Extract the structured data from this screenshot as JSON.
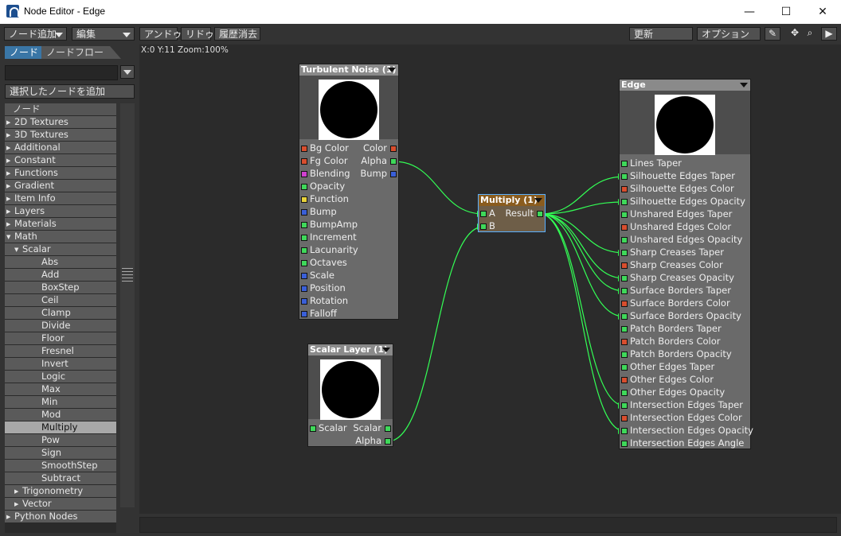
{
  "window": {
    "title": "Node Editor - Edge",
    "minimize": "—",
    "maximize": "☐",
    "close": "✕"
  },
  "toolbar": {
    "add_node": "ノード追加",
    "edit": "編集",
    "undo": "アンドゥ",
    "redo": "リドゥ",
    "clear_history": "履歴消去",
    "update": "更新",
    "options": "オプション"
  },
  "left": {
    "tab_nodes": "ノード",
    "tab_flow": "ノードフロー",
    "add_selected": "選択したノードを追加",
    "tree_header": "ノード",
    "tree": [
      {
        "label": "2D Textures",
        "level": 0,
        "expand": "closed"
      },
      {
        "label": "3D Textures",
        "level": 0,
        "expand": "closed"
      },
      {
        "label": "Additional",
        "level": 0,
        "expand": "closed"
      },
      {
        "label": "Constant",
        "level": 0,
        "expand": "closed"
      },
      {
        "label": "Functions",
        "level": 0,
        "expand": "closed"
      },
      {
        "label": "Gradient",
        "level": 0,
        "expand": "closed"
      },
      {
        "label": "Item Info",
        "level": 0,
        "expand": "closed"
      },
      {
        "label": "Layers",
        "level": 0,
        "expand": "closed"
      },
      {
        "label": "Materials",
        "level": 0,
        "expand": "closed"
      },
      {
        "label": "Math",
        "level": 0,
        "expand": "open"
      },
      {
        "label": "Scalar",
        "level": 1,
        "expand": "open"
      },
      {
        "label": "Abs",
        "level": 2
      },
      {
        "label": "Add",
        "level": 2
      },
      {
        "label": "BoxStep",
        "level": 2
      },
      {
        "label": "Ceil",
        "level": 2
      },
      {
        "label": "Clamp",
        "level": 2
      },
      {
        "label": "Divide",
        "level": 2
      },
      {
        "label": "Floor",
        "level": 2
      },
      {
        "label": "Fresnel",
        "level": 2
      },
      {
        "label": "Invert",
        "level": 2
      },
      {
        "label": "Logic",
        "level": 2
      },
      {
        "label": "Max",
        "level": 2
      },
      {
        "label": "Min",
        "level": 2
      },
      {
        "label": "Mod",
        "level": 2
      },
      {
        "label": "Multiply",
        "level": 2,
        "selected": true
      },
      {
        "label": "Pow",
        "level": 2
      },
      {
        "label": "Sign",
        "level": 2
      },
      {
        "label": "SmoothStep",
        "level": 2
      },
      {
        "label": "Subtract",
        "level": 2
      },
      {
        "label": "Trigonometry",
        "level": 1,
        "expand": "closed"
      },
      {
        "label": "Vector",
        "level": 1,
        "expand": "closed"
      },
      {
        "label": "Python Nodes",
        "level": 0,
        "expand": "closed"
      }
    ]
  },
  "canvas": {
    "coords": "X:0 Y:11 Zoom:100%"
  },
  "nodes": {
    "turbulent": {
      "title": "Turbulent Noise (1)",
      "inputs": [
        {
          "label": "Bg Color",
          "color": "orange"
        },
        {
          "label": "Fg Color",
          "color": "orange"
        },
        {
          "label": "Blending",
          "color": "magenta"
        },
        {
          "label": "Opacity",
          "color": "green"
        },
        {
          "label": "Function",
          "color": "yellow"
        },
        {
          "label": "Bump",
          "color": "blue"
        },
        {
          "label": "BumpAmp",
          "color": "green"
        },
        {
          "label": "Increment",
          "color": "green"
        },
        {
          "label": "Lacunarity",
          "color": "green"
        },
        {
          "label": "Octaves",
          "color": "green"
        },
        {
          "label": "Scale",
          "color": "blue"
        },
        {
          "label": "Position",
          "color": "blue"
        },
        {
          "label": "Rotation",
          "color": "blue"
        },
        {
          "label": "Falloff",
          "color": "blue"
        }
      ],
      "outputs": [
        {
          "label": "Color",
          "color": "orange"
        },
        {
          "label": "Alpha",
          "color": "green"
        },
        {
          "label": "Bump",
          "color": "blue"
        }
      ]
    },
    "scalarlayer": {
      "title": "Scalar Layer (1)",
      "inputs": [
        {
          "label": "Scalar",
          "color": "green"
        }
      ],
      "outputs": [
        {
          "label": "Scalar",
          "color": "green"
        },
        {
          "label": "Alpha",
          "color": "green"
        }
      ]
    },
    "multiply": {
      "title": "Multiply (1)",
      "inputs": [
        {
          "label": "A",
          "color": "green"
        },
        {
          "label": "B",
          "color": "green"
        }
      ],
      "outputs": [
        {
          "label": "Result",
          "color": "green"
        }
      ]
    },
    "edge": {
      "title": "Edge",
      "inputs": [
        {
          "label": "Lines Taper",
          "color": "green"
        },
        {
          "label": "Silhouette Edges Taper",
          "color": "green"
        },
        {
          "label": "Silhouette Edges Color",
          "color": "orange"
        },
        {
          "label": "Silhouette Edges Opacity",
          "color": "green"
        },
        {
          "label": "Unshared Edges Taper",
          "color": "green"
        },
        {
          "label": "Unshared Edges Color",
          "color": "orange"
        },
        {
          "label": "Unshared Edges Opacity",
          "color": "green"
        },
        {
          "label": "Sharp Creases Taper",
          "color": "green"
        },
        {
          "label": "Sharp Creases Color",
          "color": "orange"
        },
        {
          "label": "Sharp Creases Opacity",
          "color": "green"
        },
        {
          "label": "Surface Borders Taper",
          "color": "green"
        },
        {
          "label": "Surface Borders Color",
          "color": "orange"
        },
        {
          "label": "Surface Borders Opacity",
          "color": "green"
        },
        {
          "label": "Patch Borders Taper",
          "color": "green"
        },
        {
          "label": "Patch Borders Color",
          "color": "orange"
        },
        {
          "label": "Patch Borders Opacity",
          "color": "green"
        },
        {
          "label": "Other Edges Taper",
          "color": "green"
        },
        {
          "label": "Other Edges Color",
          "color": "orange"
        },
        {
          "label": "Other Edges Opacity",
          "color": "green"
        },
        {
          "label": "Intersection Edges Taper",
          "color": "green"
        },
        {
          "label": "Intersection Edges Color",
          "color": "orange"
        },
        {
          "label": "Intersection Edges Opacity",
          "color": "green"
        },
        {
          "label": "Intersection Edges Angle",
          "color": "green"
        }
      ],
      "connected_inputs": [
        1,
        3,
        7,
        9,
        10,
        12,
        19,
        21
      ]
    }
  },
  "colors": {
    "wire": "#33ff55",
    "selected_header": "#8a5c1e",
    "port_orange": "#d84e2e",
    "port_green": "#3fd85a",
    "port_blue": "#3a5fd8",
    "port_magenta": "#d040d0",
    "port_yellow": "#e8d23a"
  }
}
